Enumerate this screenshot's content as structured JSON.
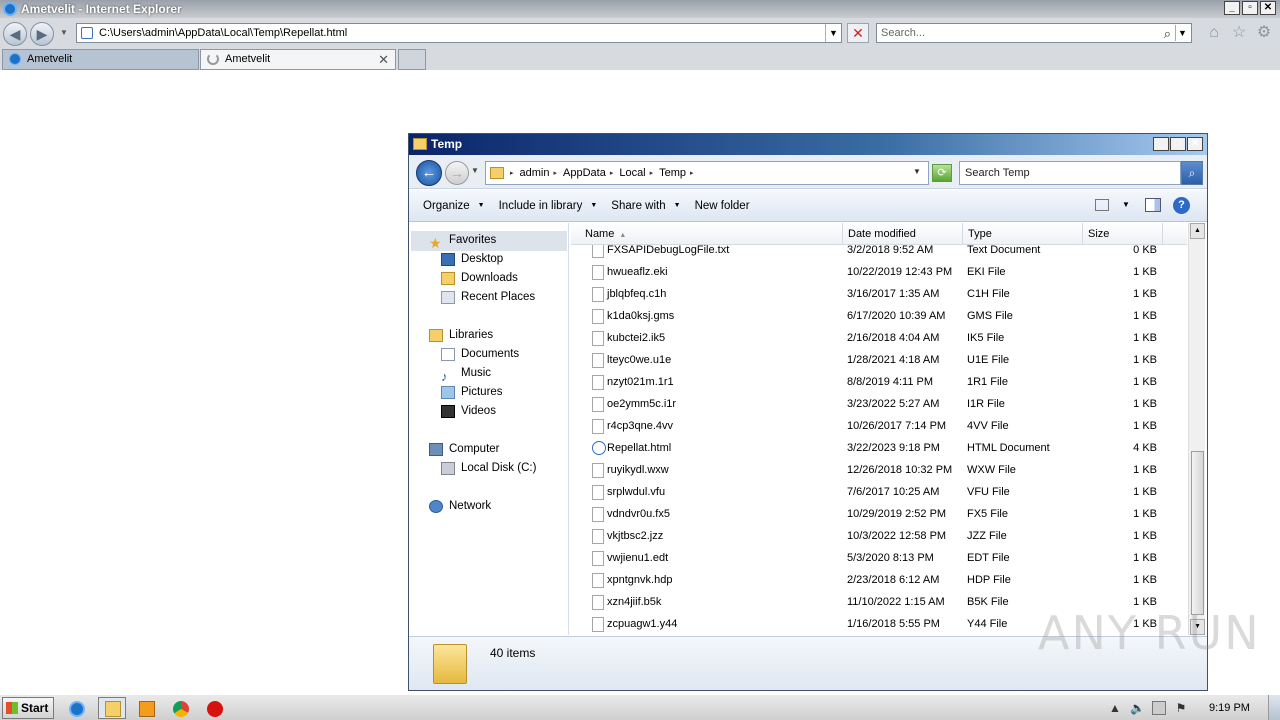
{
  "browser": {
    "title": "Ametvelit - Internet Explorer",
    "address": "C:\\Users\\admin\\AppData\\Local\\Temp\\Repellat.html",
    "search_placeholder": "Search...",
    "tabs": [
      {
        "label": "Ametvelit"
      },
      {
        "label": "Ametvelit"
      }
    ]
  },
  "explorer": {
    "title": "Temp",
    "breadcrumb": [
      "admin",
      "AppData",
      "Local",
      "Temp"
    ],
    "search_placeholder": "Search Temp",
    "commands": {
      "organize": "Organize",
      "include": "Include in library",
      "share": "Share with",
      "new_folder": "New folder"
    },
    "columns": {
      "name": "Name",
      "date": "Date modified",
      "type": "Type",
      "size": "Size"
    },
    "nav": {
      "favorites": "Favorites",
      "desktop": "Desktop",
      "downloads": "Downloads",
      "recent": "Recent Places",
      "libraries": "Libraries",
      "documents": "Documents",
      "music": "Music",
      "pictures": "Pictures",
      "videos": "Videos",
      "computer": "Computer",
      "local_disk": "Local Disk (C:)",
      "network": "Network"
    },
    "files": [
      {
        "name": "FXSAPIDebugLogFile.txt",
        "date": "3/2/2018 9:52 AM",
        "type": "Text Document",
        "size": "0 KB"
      },
      {
        "name": "hwueaflz.eki",
        "date": "10/22/2019 12:43 PM",
        "type": "EKI File",
        "size": "1 KB"
      },
      {
        "name": "jblqbfeq.c1h",
        "date": "3/16/2017 1:35 AM",
        "type": "C1H File",
        "size": "1 KB"
      },
      {
        "name": "k1da0ksj.gms",
        "date": "6/17/2020 10:39 AM",
        "type": "GMS File",
        "size": "1 KB"
      },
      {
        "name": "kubctei2.ik5",
        "date": "2/16/2018 4:04 AM",
        "type": "IK5 File",
        "size": "1 KB"
      },
      {
        "name": "lteyc0we.u1e",
        "date": "1/28/2021 4:18 AM",
        "type": "U1E File",
        "size": "1 KB"
      },
      {
        "name": "nzyt021m.1r1",
        "date": "8/8/2019 4:11 PM",
        "type": "1R1 File",
        "size": "1 KB"
      },
      {
        "name": "oe2ymm5c.i1r",
        "date": "3/23/2022 5:27 AM",
        "type": "I1R File",
        "size": "1 KB"
      },
      {
        "name": "r4cp3qne.4vv",
        "date": "10/26/2017 7:14 PM",
        "type": "4VV File",
        "size": "1 KB"
      },
      {
        "name": "Repellat.html",
        "date": "3/22/2023 9:18 PM",
        "type": "HTML Document",
        "size": "4 KB"
      },
      {
        "name": "ruyikydl.wxw",
        "date": "12/26/2018 10:32 PM",
        "type": "WXW File",
        "size": "1 KB"
      },
      {
        "name": "srplwdul.vfu",
        "date": "7/6/2017 10:25 AM",
        "type": "VFU File",
        "size": "1 KB"
      },
      {
        "name": "vdndvr0u.fx5",
        "date": "10/29/2019 2:52 PM",
        "type": "FX5 File",
        "size": "1 KB"
      },
      {
        "name": "vkjtbsc2.jzz",
        "date": "10/3/2022 12:58 PM",
        "type": "JZZ File",
        "size": "1 KB"
      },
      {
        "name": "vwjienu1.edt",
        "date": "5/3/2020 8:13 PM",
        "type": "EDT File",
        "size": "1 KB"
      },
      {
        "name": "xpntgnvk.hdp",
        "date": "2/23/2018 6:12 AM",
        "type": "HDP File",
        "size": "1 KB"
      },
      {
        "name": "xzn4jiif.b5k",
        "date": "11/10/2022 1:15 AM",
        "type": "B5K File",
        "size": "1 KB"
      },
      {
        "name": "zcpuagw1.y44",
        "date": "1/16/2018 5:55 PM",
        "type": "Y44 File",
        "size": "1 KB"
      }
    ],
    "item_count": "40 items"
  },
  "watermark": "ANY RUN",
  "taskbar": {
    "start": "Start",
    "clock": "9:19 PM"
  }
}
